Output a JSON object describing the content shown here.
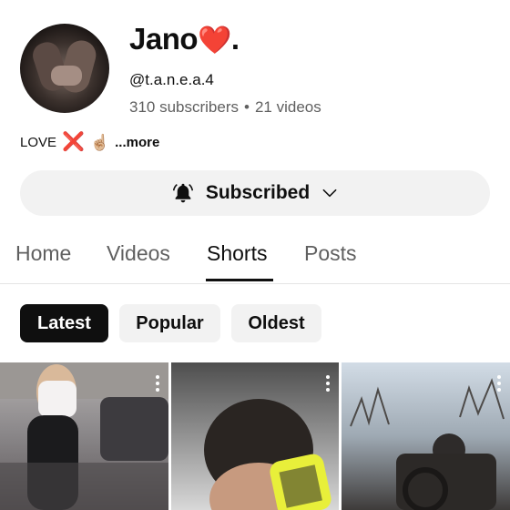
{
  "channel": {
    "name": "Jano",
    "name_suffix": ".",
    "heart": "❤️",
    "handle": "@t.a.n.e.a.4",
    "subscribers": "310 subscribers",
    "separator": "•",
    "videos": "21 videos"
  },
  "bio": {
    "text": "LOVE",
    "emoji_x": "❌",
    "emoji_hand": "☝🏼",
    "more": "...more"
  },
  "subscribe_button": {
    "label": "Subscribed",
    "icon": "bell-icon",
    "chevron": "chevron-down-icon"
  },
  "tabs": [
    {
      "label": "Home",
      "active": false
    },
    {
      "label": "Videos",
      "active": false
    },
    {
      "label": "Shorts",
      "active": true
    },
    {
      "label": "Posts",
      "active": false
    }
  ],
  "filters": [
    {
      "label": "Latest",
      "selected": true
    },
    {
      "label": "Popular",
      "selected": false
    },
    {
      "label": "Oldest",
      "selected": false
    }
  ],
  "colors": {
    "accent": "#0f0f0f",
    "heart": "#e0151b",
    "secondary_text": "#606060",
    "chip_bg": "#f2f2f2"
  }
}
